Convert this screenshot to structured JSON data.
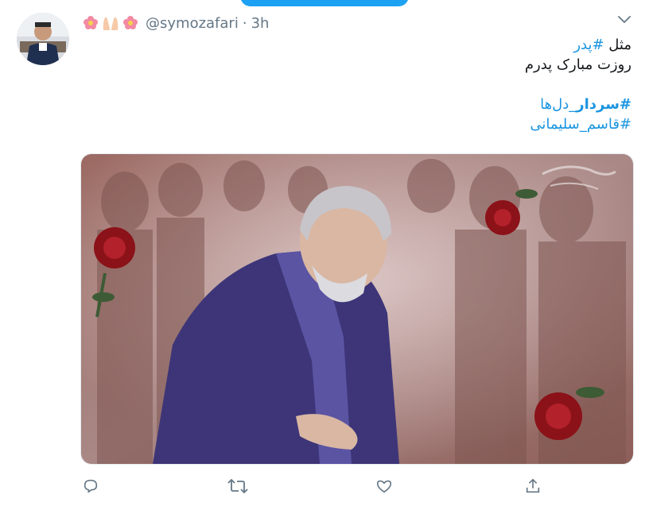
{
  "tweet": {
    "handle": "@symozafari",
    "separator": "·",
    "time": "3h",
    "emojis": [
      "flower-emoji",
      "palms-emoji",
      "flower-emoji"
    ],
    "text": {
      "line1_word": "مثل",
      "line1_hashtag": "#پدر",
      "line2": "روزت مبارک پدرم",
      "hashtag1_bold": "#سردار",
      "hashtag1_rest": "_دل‌ها",
      "hashtag2": "#قاسم_سلیمانی"
    }
  },
  "actions": [
    "reply-icon",
    "retweet-icon",
    "like-icon",
    "share-icon"
  ],
  "colors": {
    "accent": "#1b95e0",
    "icon": "#657786",
    "text": "#14171a",
    "pill": "#1da1f2"
  }
}
